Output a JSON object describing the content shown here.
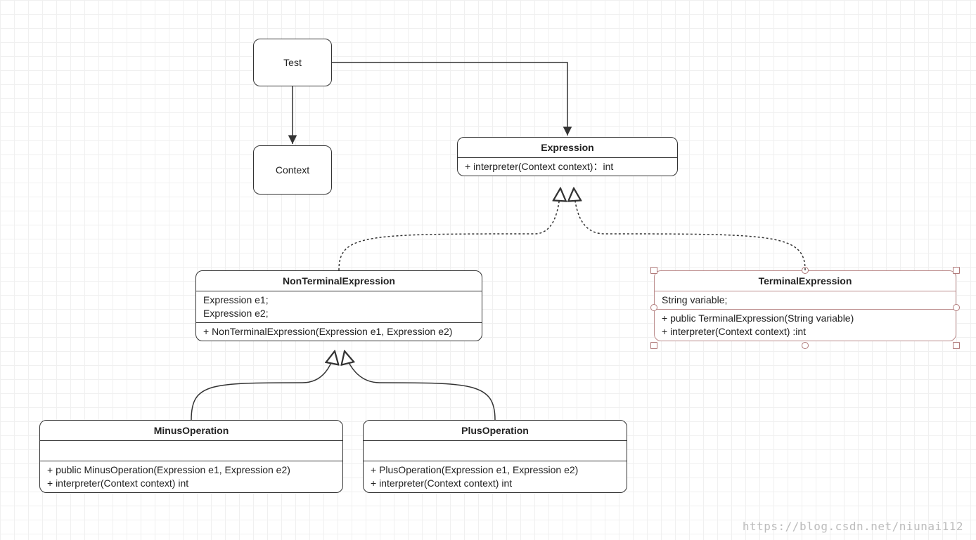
{
  "classes": {
    "test": {
      "name": "Test"
    },
    "context": {
      "name": "Context"
    },
    "expression": {
      "name": "Expression",
      "methods": [
        "+ interpreter(Context context)：int"
      ]
    },
    "nonTerminal": {
      "name": "NonTerminalExpression",
      "fields": [
        "Expression e1;",
        "Expression e2;"
      ],
      "methods": [
        "+ NonTerminalExpression(Expression e1, Expression e2)"
      ]
    },
    "terminal": {
      "name": "TerminalExpression",
      "fields": [
        "String variable;"
      ],
      "methods": [
        "+ public TerminalExpression(String variable)",
        "+ interpreter(Context context)  :int"
      ]
    },
    "minus": {
      "name": "MinusOperation",
      "methods": [
        "+ public MinusOperation(Expression e1, Expression e2)",
        "+ interpreter(Context context) int"
      ]
    },
    "plus": {
      "name": "PlusOperation",
      "methods": [
        "+ PlusOperation(Expression e1, Expression e2)",
        "+ interpreter(Context context) int"
      ]
    }
  },
  "watermark": "https://blog.csdn.net/niunai112"
}
